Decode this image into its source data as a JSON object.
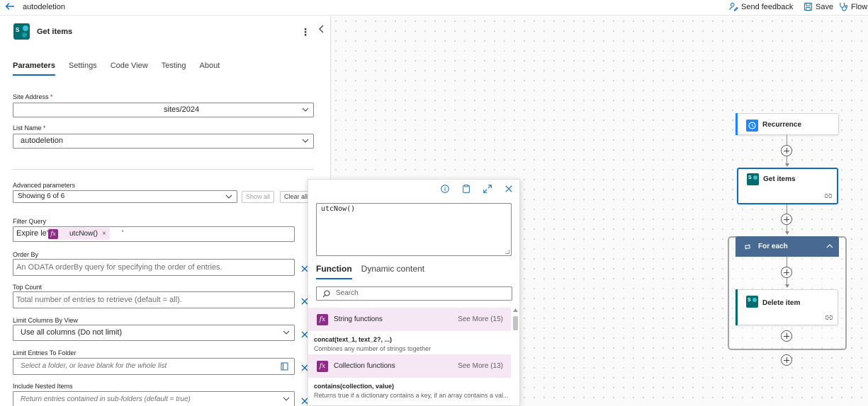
{
  "topbar": {
    "flow_name": "autodeletion",
    "send_feedback": "Send feedback",
    "save": "Save",
    "flow_checker": "Flow"
  },
  "panel": {
    "title": "Get items",
    "tabs": [
      "Parameters",
      "Settings",
      "Code View",
      "Testing",
      "About"
    ],
    "fields": {
      "site_address": {
        "label": "Site Address",
        "required": "*",
        "value": "sites/2024"
      },
      "list_name": {
        "label": "List Name",
        "required": "*",
        "value": "autodeletion"
      },
      "advanced": {
        "label": "Advanced parameters",
        "value": "Showing 6 of 6",
        "show_all": "Show all",
        "clear_all": "Clear all"
      },
      "filter_query": {
        "label": "Filter Query",
        "prefix": "Expire le'",
        "token": "utcNow()",
        "token_close": "×",
        "suffix": "'"
      },
      "order_by": {
        "label": "Order By",
        "placeholder": "An ODATA orderBy query for specifying the order of entries."
      },
      "top_count": {
        "label": "Top Count",
        "placeholder": "Total number of entries to retrieve (default = all)."
      },
      "limit_columns": {
        "label": "Limit Columns By View",
        "value": "Use all columns (Do not limit)"
      },
      "limit_folder": {
        "label": "Limit Entries To Folder",
        "placeholder": "Select a folder, or leave blank for the whole list"
      },
      "nested": {
        "label": "Include Nested Items",
        "placeholder": "Return entries contained in sub-folders (default = true)"
      }
    }
  },
  "popup": {
    "expression": "utcNow()",
    "tabs": [
      "Function",
      "Dynamic content"
    ],
    "search_placeholder": "Search",
    "categories": [
      {
        "name": "String functions",
        "see_more": "See More (15)"
      },
      {
        "name": "Collection functions",
        "see_more": "See More (13)"
      }
    ],
    "functions": [
      {
        "signature": "concat(text_1, text_2?, ...)",
        "description": "Combines any number of strings together"
      },
      {
        "signature": "contains(collection, value)",
        "description": "Returns true if a dictionary contains a key, if an array contains a val..."
      }
    ],
    "fx_glyph": "fx"
  },
  "flow": {
    "recurrence": "Recurrence",
    "get_items": "Get items",
    "for_each": "For each",
    "delete_item": "Delete item"
  },
  "colors": {
    "accent_blue": "#0f6cbd",
    "sharepoint_teal": "#036c70",
    "fx_purple": "#8c2c86",
    "token_bg": "#f7e7f5",
    "scope_header": "#486991",
    "recurrence_blue": "#1f85ff"
  }
}
